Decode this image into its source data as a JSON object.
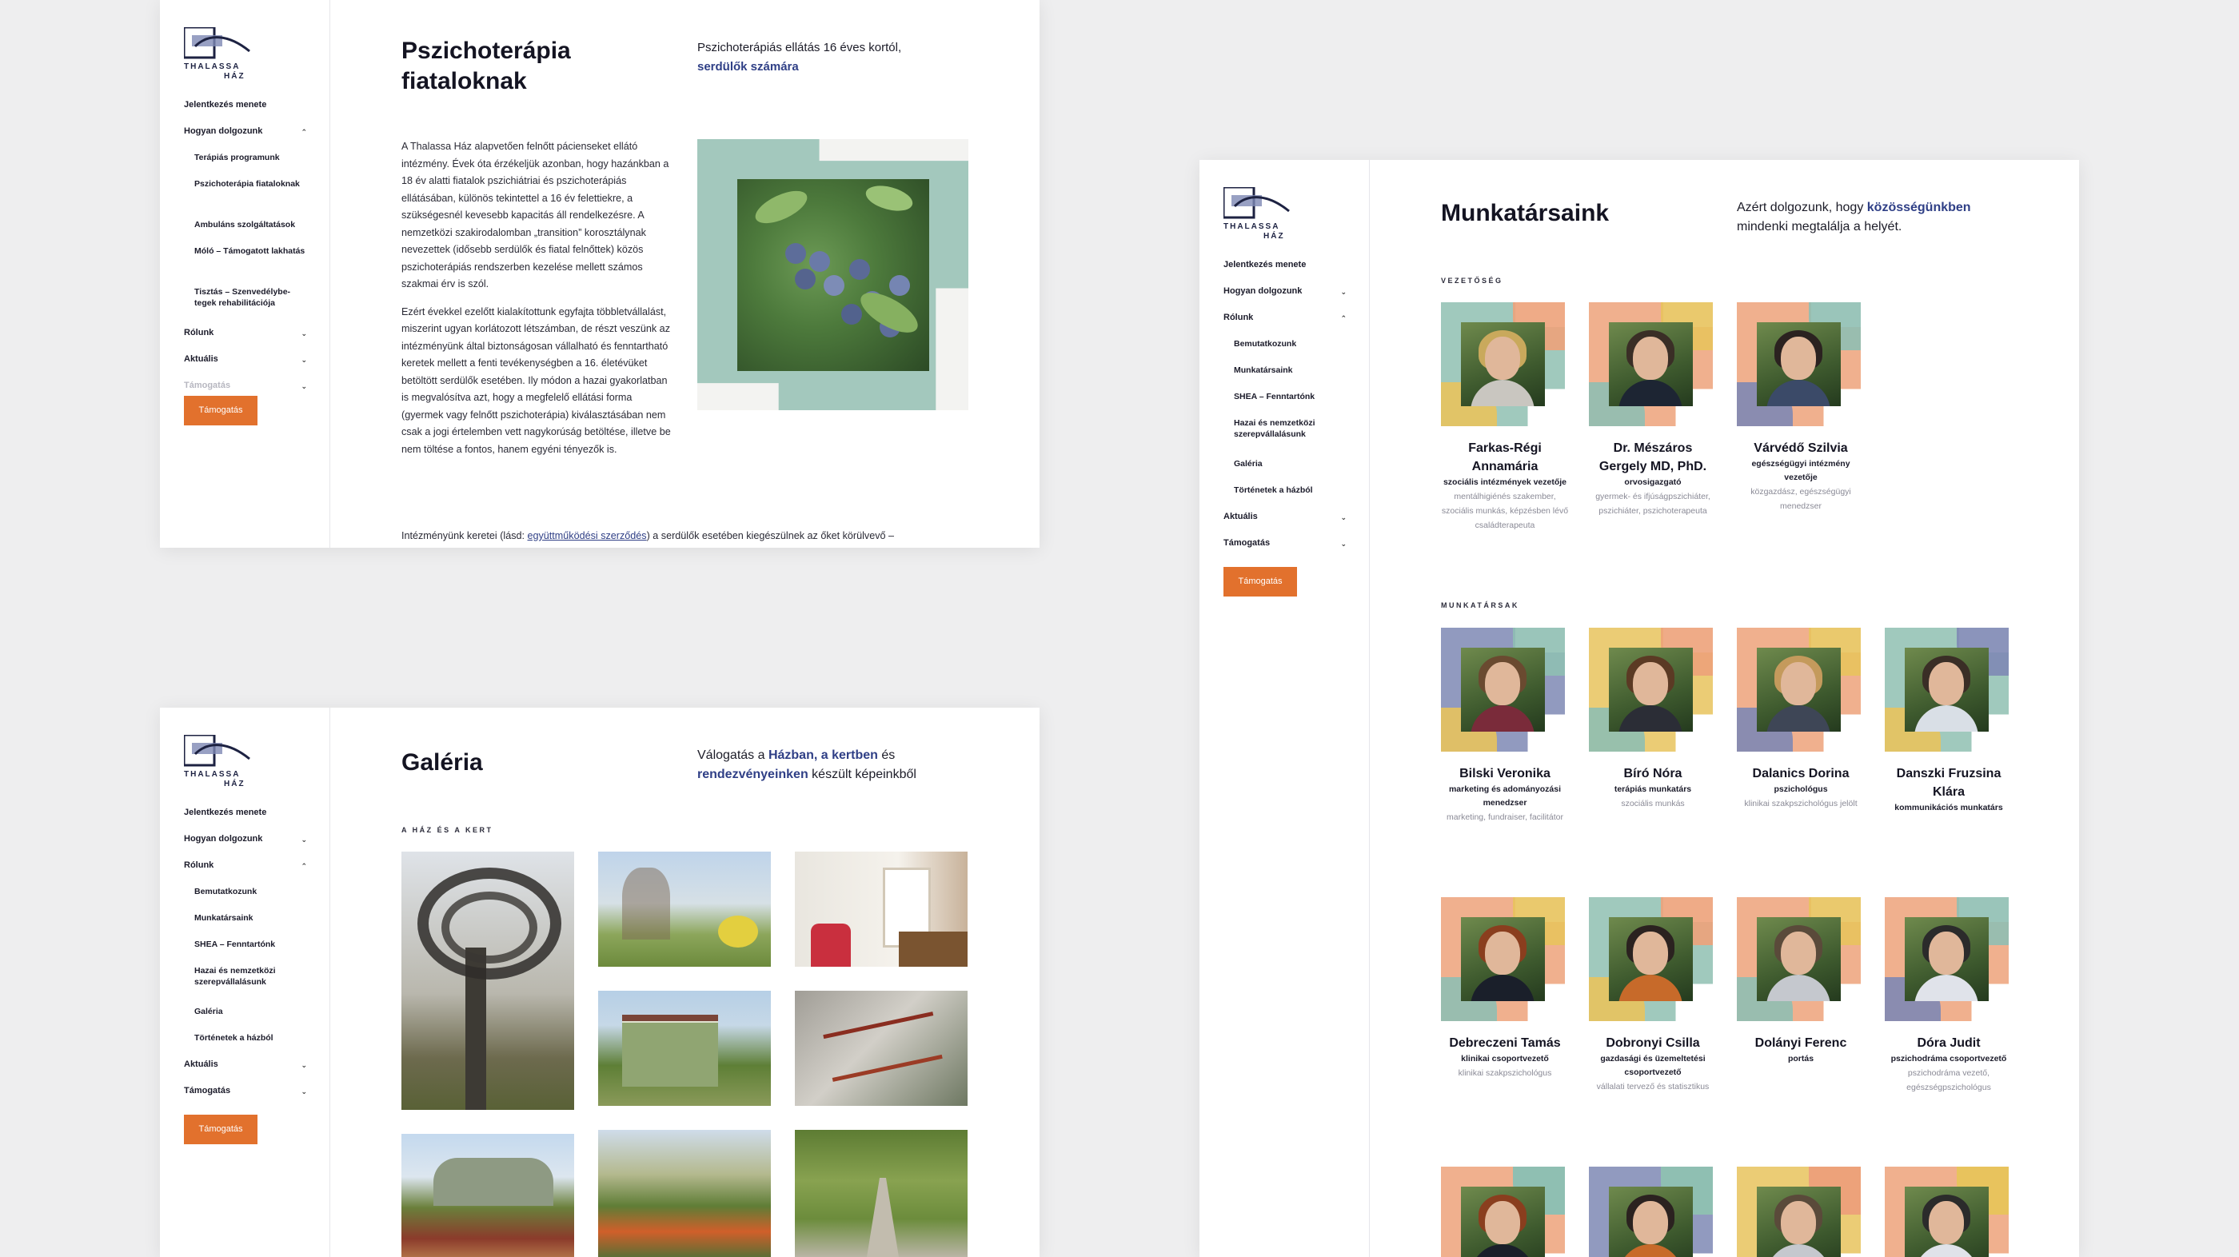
{
  "logo": {
    "line1": "THALASSA",
    "line2": "HÁZ"
  },
  "nav_a": [
    {
      "label": "Jelentkezés menete",
      "level": 0,
      "chev": ""
    },
    {
      "label": "Hogyan dolgozunk",
      "level": 0,
      "chev": "^"
    },
    {
      "label": "Terápiás programunk",
      "level": 1,
      "chev": ""
    },
    {
      "label": "Pszichoterápia fiataloknak",
      "level": 1,
      "chev": ""
    },
    {
      "label": "Ambuláns szolgáltatások",
      "level": 1,
      "chev": ""
    },
    {
      "label": "Móló – Támogatott lakhatás",
      "level": 1,
      "chev": ""
    },
    {
      "label": "Tisztás – Szenvedélybe-tegek rehabilitációja",
      "level": 1,
      "chev": ""
    },
    {
      "label": "Rólunk",
      "level": 0,
      "chev": "v"
    },
    {
      "label": "Aktuális",
      "level": 0,
      "chev": "v"
    },
    {
      "label": "Támogatás",
      "level": 0,
      "chev": "v"
    }
  ],
  "nav_b": [
    {
      "label": "Jelentkezés menete",
      "level": 0,
      "chev": ""
    },
    {
      "label": "Hogyan dolgozunk",
      "level": 0,
      "chev": "v"
    },
    {
      "label": "Rólunk",
      "level": 0,
      "chev": "^"
    },
    {
      "label": "Bemutatkozunk",
      "level": 1,
      "chev": ""
    },
    {
      "label": "Munkatársaink",
      "level": 1,
      "chev": ""
    },
    {
      "label": "SHEA – Fenntartónk",
      "level": 1,
      "chev": ""
    },
    {
      "label": "Hazai és nemzetközi szerepvállalásunk",
      "level": 1,
      "chev": ""
    },
    {
      "label": "Galéria",
      "level": 1,
      "chev": ""
    },
    {
      "label": "Történetek a házból",
      "level": 1,
      "chev": ""
    },
    {
      "label": "Aktuális",
      "level": 0,
      "chev": "v"
    },
    {
      "label": "Támogatás",
      "level": 0,
      "chev": "v"
    }
  ],
  "support_button": "Támogatás",
  "page_a": {
    "title_line1": "Pszichoterápia",
    "title_line2": "fiataloknak",
    "lead_plain": "Pszichoterápiás ellátás 16 éves kortól,",
    "lead_bold": "serdülők számára",
    "p1": "A Thalassa Ház alapvetően felnőtt pácienseket ellátó intézmény. Évek óta érzékeljük azonban, hogy hazánkban a 18 év alatti fiatalok pszichiátriai és pszichoterápiás ellátásában, különös tekintettel a 16 év felettiekre, a szükségesnél kevesebb kapacitás áll rendelkezésre. A nemzetközi szakirodalomban „transition” korosztálynak nevezettek (idősebb serdülők és fiatal felnőttek) közös pszichoterápiás rendszerben kezelése mellett számos szakmai érv is szól.",
    "p2": "Ezért évekkel ezelőtt kialakítottunk egyfajta többletvállalást, miszerint ugyan korlátozott létszámban, de részt veszünk az intézményünk által biztonságosan vállalható és fenntartható keretek mellett a fenti tevékenységben a 16. életévüket betöltött serdülők esetében. Ily módon a hazai gyakorlatban is megvalósítva azt, hogy a megfelelő ellátási forma (gyermek vagy felnőtt pszichoterápia) kiválasztásában nem csak a jogi értelemben vett nagykorúság betöltése, illetve be nem töltése a fontos, hanem egyéni tényezők is.",
    "p3_before": "Intézményünk keretei (lásd: ",
    "p3_link": "együttműködési szerződés",
    "p3_after": ") a serdülők esetében kiegészülnek az őket körülvevő –"
  },
  "page_b": {
    "title": "Galéria",
    "lead_1": "Válogatás a ",
    "lead_b1": "Házban, a kertben",
    "lead_2": " és",
    "lead_b2": "rendezvényeinken",
    "lead_3": " készült képeinkből",
    "section": "A HÁZ ÉS A KERT"
  },
  "page_c": {
    "title": "Munkatársaink",
    "lead_1": "Azért dolgozunk, hogy ",
    "lead_b": "közösségünkben",
    "lead_2": "mindenki megtalálja a helyét.",
    "section_lead": "VEZETŐSÉG",
    "section_staff": "MUNKATÁRSAK",
    "leaders": [
      {
        "name": "Farkas-Régi Annamária",
        "role": "szociális intézmények vezetője",
        "desc": "mentálhigiénés szakember, szociális munkás, képzésben lévő családterapeuta"
      },
      {
        "name": "Dr. Mészáros Gergely MD, PhD.",
        "role": "orvosigazgató",
        "desc": "gyermek- és ifjúságpszichiáter, pszichiáter, pszichoterapeuta"
      },
      {
        "name": "Várvédő Szilvia",
        "role": "egészségügyi intézmény vezetője",
        "desc": "közgazdász, egészségügyi menedzser"
      }
    ],
    "staff": [
      {
        "name": "Bilski Veronika",
        "role": "marketing és adományozási menedzser",
        "desc": "marketing, fundraiser, facilitátor"
      },
      {
        "name": "Bíró Nóra",
        "role": "terápiás munkatárs",
        "desc": "szociális munkás"
      },
      {
        "name": "Dalanics Dorina",
        "role": "pszichológus",
        "desc": "klinikai szakpszichológus jelölt"
      },
      {
        "name": "Danszki Fruzsina Klára",
        "role": "kommunikációs munkatárs",
        "desc": ""
      },
      {
        "name": "Debreczeni Tamás",
        "role": "klinikai csoportvezető",
        "desc": "klinikai szakpszichológus"
      },
      {
        "name": "Dobronyi Csilla",
        "role": "gazdasági és üzemeltetési csoportvezető",
        "desc": "vállalati tervező és statisztikus"
      },
      {
        "name": "Dolányi Ferenc",
        "role": "portás",
        "desc": ""
      },
      {
        "name": "Dóra Judit",
        "role": "pszichodráma csoportvezető",
        "desc": "pszichodráma vezető, egészségpszichológus"
      }
    ]
  },
  "colors": {
    "accent": "#e2712d",
    "link": "#2f3f86",
    "teal": "#8fbfb2",
    "orange": "#eda27a",
    "yellow": "#e8c35d",
    "slate": "#7e88b4"
  }
}
